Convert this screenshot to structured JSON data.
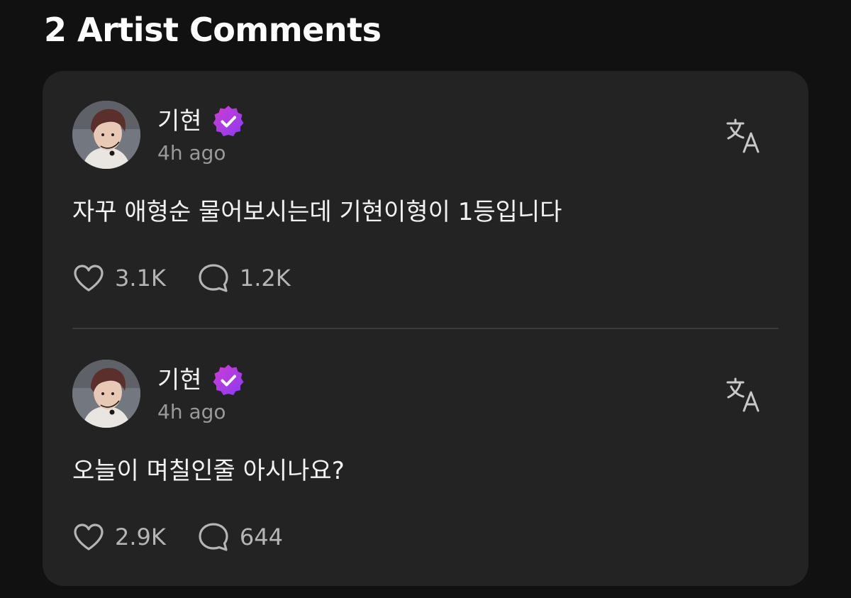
{
  "section": {
    "title": "2 Artist Comments"
  },
  "comments": [
    {
      "author": "기현",
      "verified_badge_icon": "verified-badge-icon",
      "time": "4h ago",
      "text": "자꾸 애형순 물어보시는데 기현이형이 1등입니다",
      "likes": "3.1K",
      "replies": "1.2K",
      "translate_icon": "translate-icon"
    },
    {
      "author": "기현",
      "verified_badge_icon": "verified-badge-icon",
      "time": "4h ago",
      "text": "오늘이 며칠인줄 아시나요?",
      "likes": "2.9K",
      "replies": "644",
      "translate_icon": "translate-icon"
    }
  ],
  "colors": {
    "background": "#111111",
    "card": "#232323",
    "badge_gradient_start": "#c23ad9",
    "badge_gradient_end": "#8a3cf0",
    "muted_text": "#9a9a9a"
  }
}
